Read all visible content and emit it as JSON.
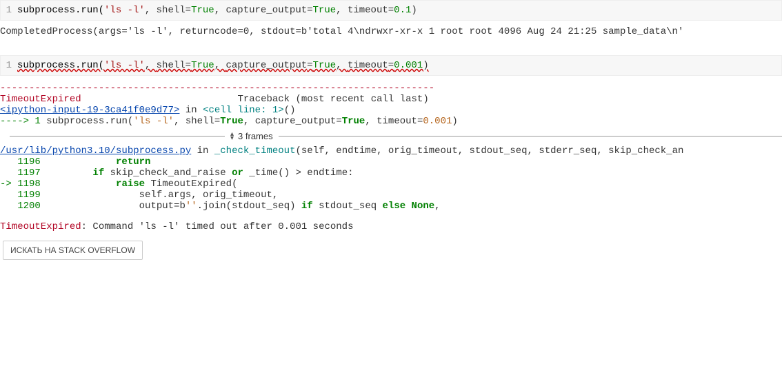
{
  "cell1": {
    "lineno": "1",
    "code_prefix": "subprocess.run(",
    "arg_str": "'ls -l'",
    "arg_shell_k": "shell",
    "arg_eq": "=",
    "arg_true": "True",
    "arg_cap_k": "capture_output",
    "arg_to_k": "timeout",
    "arg_to_v": "0.1",
    "close": ")"
  },
  "output1": "CompletedProcess(args='ls -l', returncode=0, stdout=b'total 4\\ndrwxr-xr-x 1 root root 4096 Aug 24 21:25 sample_data\\n'",
  "cell2": {
    "lineno": "1",
    "code_prefix": "subprocess.run(",
    "arg_str": "'ls -l'",
    "arg_to_v": "0.001",
    "close": ")"
  },
  "tb": {
    "dashes": "---------------------------------------------------------------------------",
    "exc": "TimeoutExpired",
    "exc_pad": "                           ",
    "tb_label": "Traceback (most recent call last)",
    "ipy_link": "<ipython-input-19-3ca41f0e9d77>",
    "in_txt": " in ",
    "cell_line": "<cell line: 1>",
    "parens": "()",
    "arrow": "----> ",
    "ln1": "1",
    "call_prefix": " subprocess.run(",
    "call_str": "'ls -l'",
    "call_rest1": ", shell",
    "call_true": "True",
    "call_rest2": ", capture_output",
    "call_rest3": ", timeout",
    "call_num": "0.001",
    "call_close": ")"
  },
  "frames": {
    "label": "3 frames"
  },
  "tb2": {
    "file_link": "/usr/lib/python3.10/subprocess.py",
    "in_txt": " in ",
    "func": "_check_timeout",
    "sig": "(self, endtime, orig_timeout, stdout_seq, stderr_seq, skip_check_an",
    "l1196_no": "   1196",
    "l1196_code": "             return",
    "l1197_no": "   1197",
    "l1197_if": "         if",
    "l1197_rest": " skip_check_and_raise ",
    "l1197_or": "or",
    "l1197_rest2": " _time() > endtime:",
    "l1198_arrow": "-> ",
    "l1198_no": "1198",
    "l1198_raise": "             raise",
    "l1198_rest": " TimeoutExpired(",
    "l1199_no": "   1199",
    "l1199_code": "                 self.args, orig_timeout,",
    "l1200_no": "   1200",
    "l1200_pre": "                 output=b",
    "l1200_str": "''",
    "l1200_mid": ".join(stdout_seq) ",
    "l1200_if": "if",
    "l1200_mid2": " stdout_seq ",
    "l1200_else": "else",
    "l1200_none": " None",
    "l1200_comma": ","
  },
  "final": {
    "exc": "TimeoutExpired",
    "msg": ": Command 'ls -l' timed out after 0.001 seconds"
  },
  "button": {
    "label": "ИСКАТЬ НА STACK OVERFLOW"
  }
}
